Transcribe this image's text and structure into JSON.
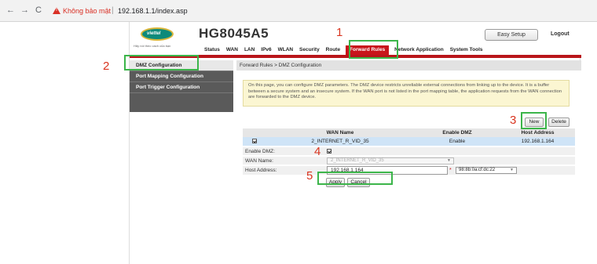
{
  "browser": {
    "back_icon": "←",
    "forward_icon": "→",
    "reload_icon": "C",
    "security_label": "Không bảo mật",
    "separator": "|",
    "url": "192.168.1.1/index.asp"
  },
  "header": {
    "logo_text": "viettel",
    "tagline": "Hãy nói theo cách của bạn",
    "device_name": "HG8045A5",
    "easy_setup_label": "Easy Setup",
    "logout_label": "Logout"
  },
  "menu": {
    "items": [
      "Status",
      "WAN",
      "LAN",
      "IPv6",
      "WLAN",
      "Security",
      "Route",
      "Forward Rules",
      "Network Application",
      "System Tools"
    ],
    "active": "Forward Rules"
  },
  "sidebar": {
    "items": [
      "DMZ Configuration",
      "Port Mapping Configuration",
      "Port Trigger Configuration"
    ],
    "selected": "DMZ Configuration"
  },
  "main": {
    "breadcrumb": "Forward Rules > DMZ Configuration",
    "info": "On this page, you can configure DMZ parameters. The DMZ device restricts unreliable external connections from linking up to the device. It is a buffer between a secure system and an insecure system. If the WAN port is not listed in the port mapping table, the application requests from the WAN connection are forwarded to the DMZ device.",
    "new_label": "New",
    "delete_label": "Delete",
    "table": {
      "headers": [
        "",
        "WAN Name",
        "Enable DMZ",
        "Host Address"
      ],
      "rows": [
        {
          "checked": true,
          "wan_name": "2_INTERNET_R_VID_35",
          "enable_dmz": "Enable",
          "host_address": "192.168.1.164"
        }
      ]
    },
    "form": {
      "enable_dmz_label": "Enable DMZ:",
      "enable_dmz_checked": true,
      "wan_name_label": "WAN Name:",
      "wan_name_value": "2_INTERNET_R_VID_35",
      "host_address_label": "Host Address:",
      "host_address_value": "192.168.1.164",
      "required_mark": "*",
      "mac_value": "98:8b:0a:cf:dc:22",
      "apply_label": "Apply",
      "cancel_label": "Cancel"
    }
  },
  "annotations": [
    "1",
    "2",
    "3",
    "4",
    "5"
  ],
  "colors": {
    "accent_red": "#c8151b",
    "highlight_green": "#3cb54a",
    "annotation_red": "#d9341f",
    "info_bg": "#fbf6d2",
    "selected_row": "#cfe4f7"
  }
}
